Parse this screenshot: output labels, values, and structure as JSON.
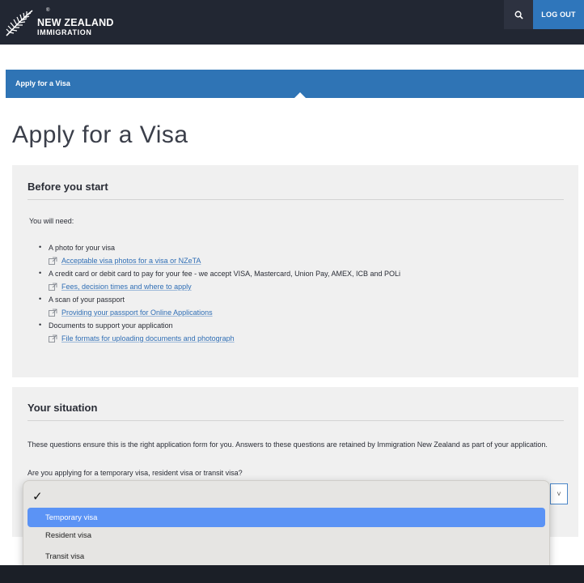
{
  "header": {
    "logo_line1": "NEW ZEALAND",
    "logo_line2": "IMMIGRATION",
    "logo_reg": "®",
    "search_icon": "search-icon",
    "logout_label": "LOG OUT"
  },
  "breadcrumb": {
    "label": "Apply for a Visa"
  },
  "page": {
    "title": "Apply for a Visa"
  },
  "before_you_start": {
    "heading": "Before you start",
    "intro": "You will need:",
    "items": [
      {
        "text": "A photo for your visa",
        "link": "Acceptable visa photos for a visa or NZeTA"
      },
      {
        "text": "A credit card or debit card to pay for your fee - we accept VISA, Mastercard, Union Pay, AMEX, ICB and POLi",
        "link": "Fees, decision times and where to apply"
      },
      {
        "text": "A scan of your passport",
        "link": "Providing your passport for Online Applications"
      },
      {
        "text": "Documents to support your application",
        "link": "File formats for uploading documents and photograph"
      }
    ]
  },
  "situation": {
    "heading": "Your situation",
    "intro": "These questions ensure this is the right application form for you. Answers to these questions are retained by Immigration New Zealand as part of your application.",
    "question": "Are you applying for a temporary visa, resident visa or transit visa?",
    "select_chevron": "˅",
    "dropdown": {
      "checkmark": "✓",
      "options": [
        "Temporary visa",
        "Resident visa",
        "Transit visa"
      ],
      "highlighted": "Temporary visa"
    }
  },
  "colors": {
    "topbar": "#222733",
    "accent_blue": "#2f74b5",
    "panel_bg": "#f0f0f0",
    "highlight": "#5b93f5"
  }
}
